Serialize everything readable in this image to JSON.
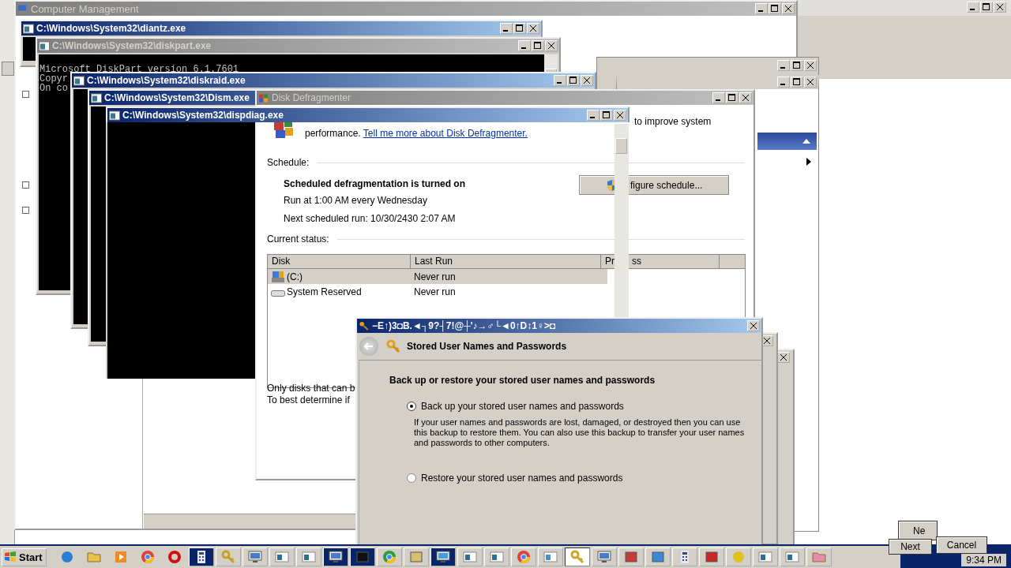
{
  "windows": [
    {
      "kind": "management",
      "title": "Computer Management",
      "active": false
    },
    {
      "kind": "console",
      "title": "C:\\Windows\\System32\\diantz.exe",
      "active": true
    },
    {
      "kind": "console",
      "title": "C:\\Windows\\System32\\diskpart.exe",
      "active": false,
      "lines": [
        "Microsoft DiskPart version 6.1.7601",
        "Copyr",
        "On co"
      ]
    },
    {
      "kind": "console",
      "title": "C:\\Windows\\System32\\diskraid.exe",
      "active": true
    },
    {
      "kind": "console",
      "title": "C:\\Windows\\System32\\Dism.exe",
      "active": true
    },
    {
      "kind": "defragmenter",
      "title": "Disk Defragmenter",
      "active": false
    },
    {
      "kind": "console",
      "title": "C:\\Windows\\System32\\dispdiag.exe",
      "active": true
    }
  ],
  "defragmenter": {
    "intro_tail": "to improve system",
    "intro_start": "performance.",
    "intro_link": "Tell me more about Disk Defragmenter.",
    "schedule_label": "Schedule:",
    "schedule_status": "Scheduled defragmentation is turned on",
    "schedule_run": "Run at 1:00 AM every Wednesday",
    "schedule_next": "Next scheduled run: 10/30/2430 2:07 AM",
    "configure_button": "figure schedule...",
    "status_label": "Current status:",
    "columns": [
      "Disk",
      "Last Run",
      "Pr",
      "ss"
    ],
    "rows": [
      {
        "disk": "(C:)",
        "last_run": "Never run",
        "kind": "system",
        "selected": true
      },
      {
        "disk": "System Reserved",
        "last_run": "Never run",
        "kind": "plain",
        "selected": false
      }
    ],
    "notes": [
      "Only disks that can b",
      "To best determine if"
    ]
  },
  "dialog": {
    "title": "−E↑)3◘B.◄┐9?┤7!@┼'♪→♂└◄0↑D↕1♀>◘",
    "header": "Stored User Names and Passwords",
    "heading": "Back up or restore your stored user names and passwords",
    "options": [
      {
        "label": "Back up your stored user names and passwords",
        "selected": true,
        "description": "If your user names and passwords are lost, damaged, or destroyed then you can use this backup to restore them. You can also use this backup to transfer your user names and passwords to other computers."
      },
      {
        "label": "Restore your stored user names and passwords",
        "selected": false
      }
    ]
  },
  "wizard_buttons": [
    "Ne",
    "Next",
    "Cancel"
  ],
  "taskbar": {
    "start": "Start",
    "clock": "9:34 PM",
    "items": [
      {
        "kind": "launcher",
        "selected": false,
        "flashing": false
      },
      {
        "kind": "launcher",
        "selected": false,
        "flashing": false
      },
      {
        "kind": "launcher",
        "selected": false,
        "flashing": false
      },
      {
        "kind": "launcher",
        "selected": false,
        "flashing": false
      },
      {
        "kind": "launcher",
        "selected": false,
        "flashing": false
      },
      {
        "kind": "task",
        "selected": false,
        "flashing": true
      },
      {
        "kind": "task",
        "selected": false,
        "flashing": false
      },
      {
        "kind": "task",
        "selected": false,
        "flashing": false
      },
      {
        "kind": "task",
        "selected": false,
        "flashing": false
      },
      {
        "kind": "task",
        "selected": false,
        "flashing": false
      },
      {
        "kind": "task",
        "selected": false,
        "flashing": true
      },
      {
        "kind": "task",
        "selected": false,
        "flashing": true
      },
      {
        "kind": "task",
        "selected": false,
        "flashing": false
      },
      {
        "kind": "task",
        "selected": false,
        "flashing": false
      },
      {
        "kind": "task",
        "selected": false,
        "flashing": true
      },
      {
        "kind": "task",
        "selected": false,
        "flashing": false
      },
      {
        "kind": "task",
        "selected": false,
        "flashing": false
      },
      {
        "kind": "task",
        "selected": false,
        "flashing": false
      },
      {
        "kind": "task",
        "selected": false,
        "flashing": false
      },
      {
        "kind": "task",
        "selected": true,
        "flashing": false
      },
      {
        "kind": "task",
        "selected": false,
        "flashing": false
      },
      {
        "kind": "task",
        "selected": false,
        "flashing": false
      },
      {
        "kind": "task",
        "selected": false,
        "flashing": false
      },
      {
        "kind": "task",
        "selected": false,
        "flashing": false
      },
      {
        "kind": "task",
        "selected": false,
        "flashing": false
      },
      {
        "kind": "task",
        "selected": false,
        "flashing": false
      },
      {
        "kind": "task",
        "selected": false,
        "flashing": false
      },
      {
        "kind": "task",
        "selected": false,
        "flashing": false
      },
      {
        "kind": "task",
        "selected": false,
        "flashing": false
      }
    ]
  }
}
